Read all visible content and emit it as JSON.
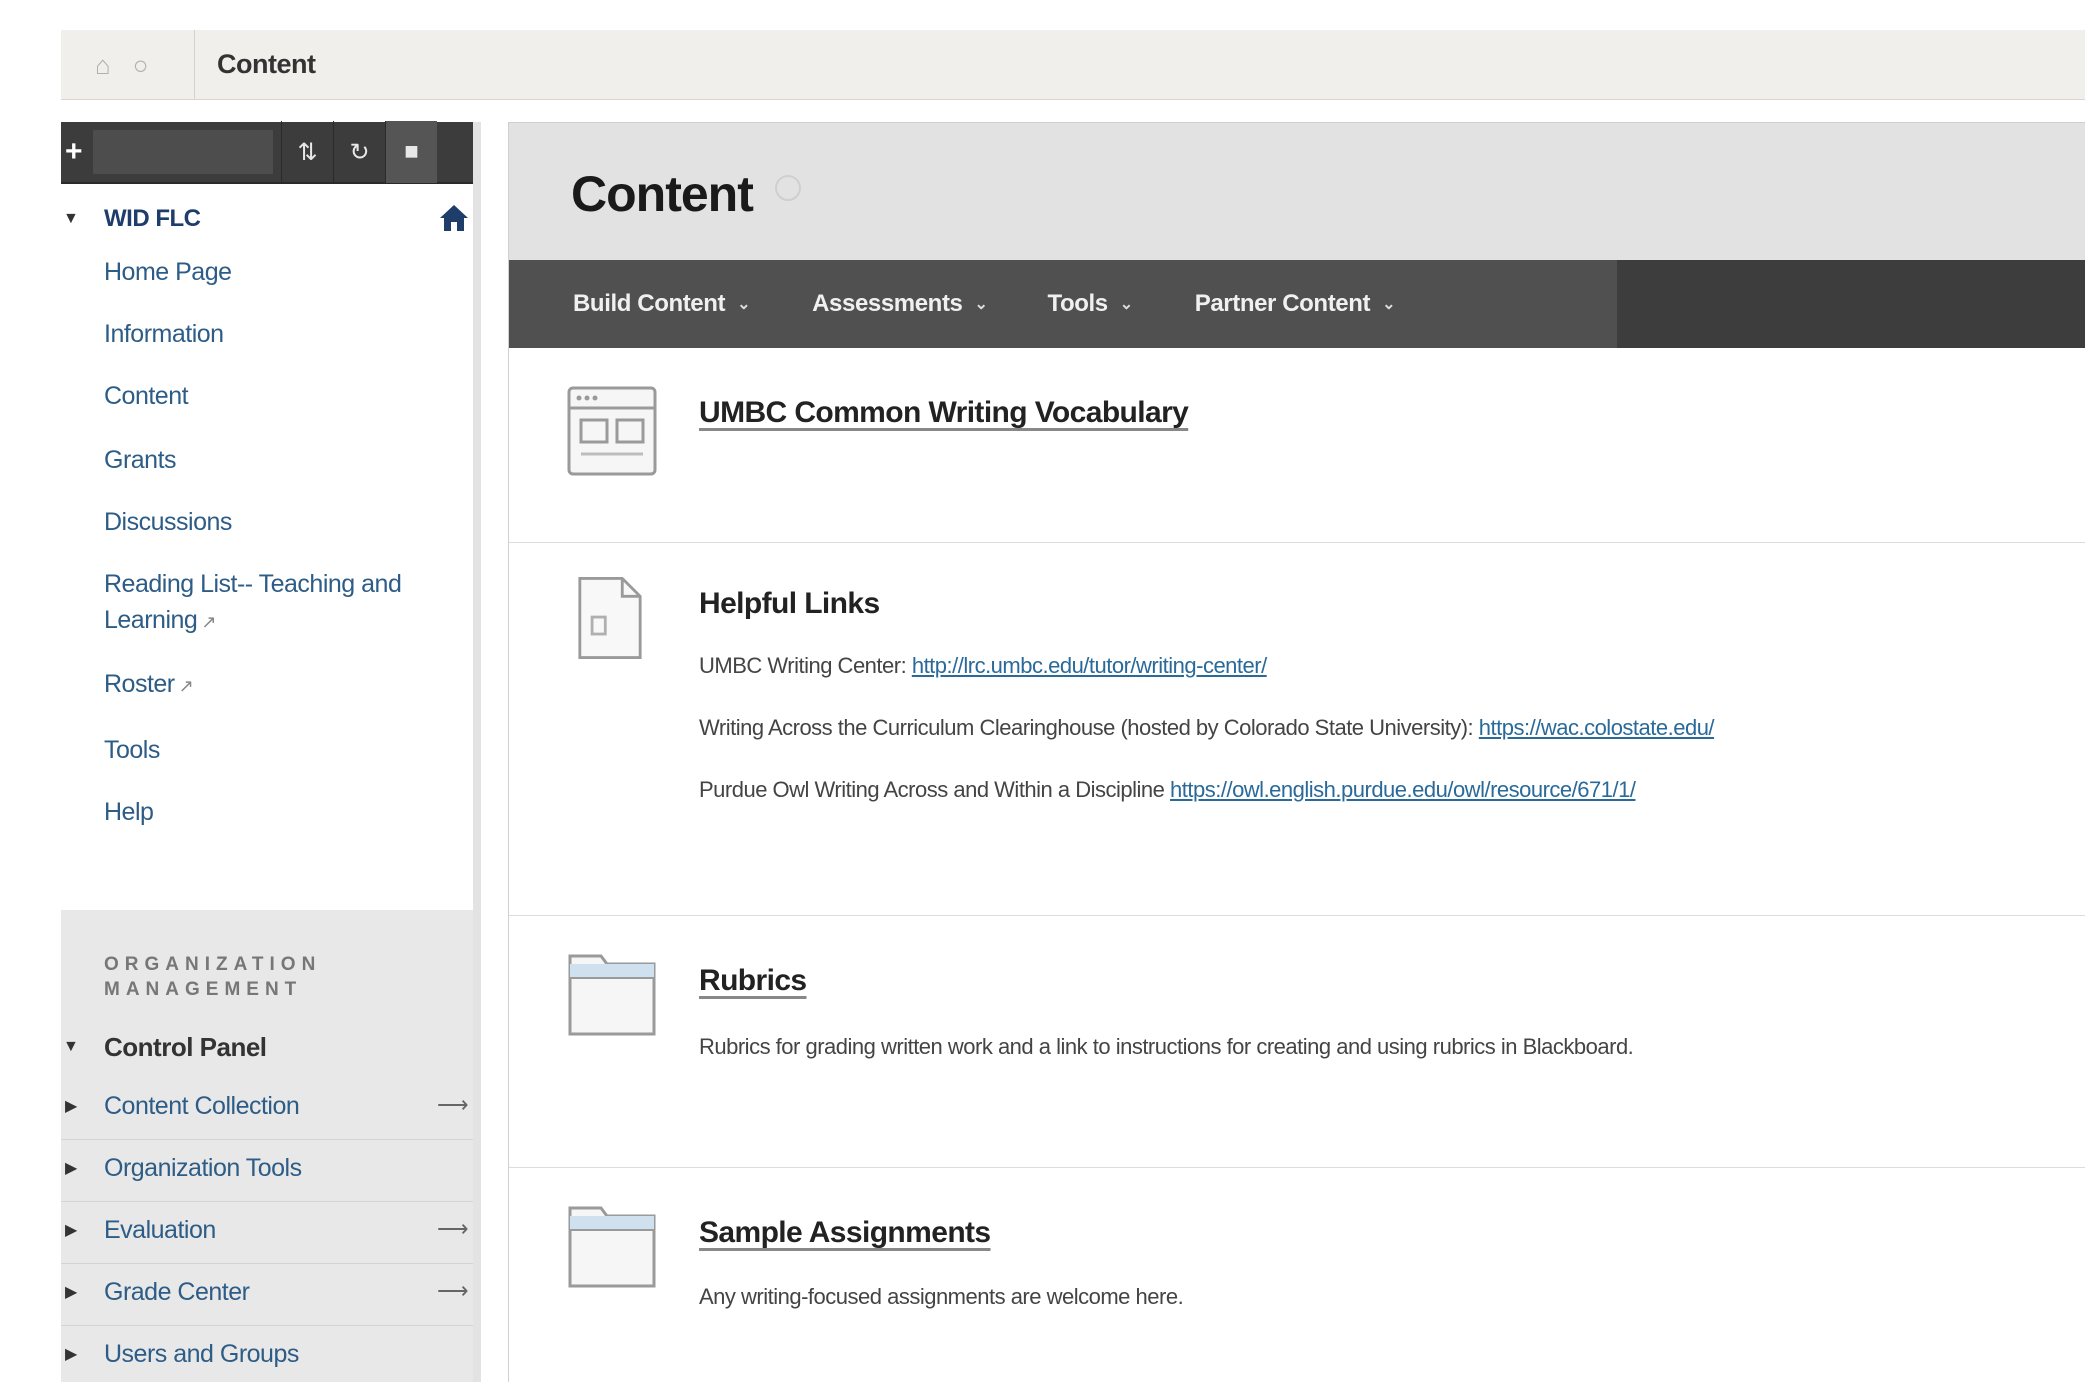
{
  "breadcrumb": {
    "current": "Content"
  },
  "sidebar": {
    "course_name": "WID FLC",
    "menu": [
      {
        "label": "Home Page",
        "external": false
      },
      {
        "label": "Information",
        "external": false
      },
      {
        "label": "Content",
        "external": false
      },
      {
        "label": "Grants",
        "external": false
      },
      {
        "label": "Discussions",
        "external": false
      },
      {
        "label": "Reading List-- Teaching and Learning",
        "external": true
      },
      {
        "label": "Roster",
        "external": true
      },
      {
        "label": "Tools",
        "external": false
      },
      {
        "label": "Help",
        "external": false
      }
    ],
    "management_caption": "ORGANIZATION MANAGEMENT",
    "control_panel": "Control Panel",
    "control_items": [
      {
        "label": "Content Collection",
        "arrow": true
      },
      {
        "label": "Organization Tools",
        "arrow": false
      },
      {
        "label": "Evaluation",
        "arrow": true
      },
      {
        "label": "Grade Center",
        "arrow": true
      },
      {
        "label": "Users and Groups",
        "arrow": false
      }
    ]
  },
  "main": {
    "title": "Content",
    "actions": [
      "Build Content",
      "Assessments",
      "Tools",
      "Partner Content"
    ],
    "items": {
      "vocab": {
        "title": "UMBC Common Writing Vocabulary"
      },
      "links": {
        "title": "Helpful Links",
        "l1_text": "UMBC Writing Center:",
        "l1_url": "http://lrc.umbc.edu/tutor/writing-center/",
        "l2_text": "Writing Across the Curriculum Clearinghouse (hosted by Colorado State University):",
        "l2_url": "https://wac.colostate.edu/",
        "l3_text": "Purdue Owl Writing Across and Within a Discipline",
        "l3_url": "https://owl.english.purdue.edu/owl/resource/671/1/"
      },
      "rubrics": {
        "title": "Rubrics",
        "desc": "Rubrics for grading written work and a link to instructions for creating and using rubrics in Blackboard."
      },
      "samples": {
        "title": "Sample Assignments",
        "desc": "Any writing-focused assignments are welcome here."
      }
    }
  }
}
